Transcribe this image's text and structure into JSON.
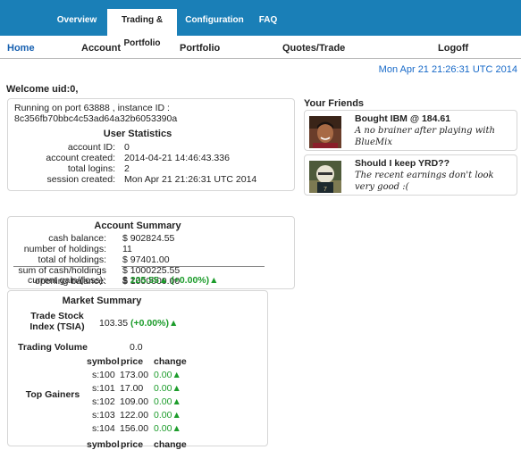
{
  "tabs": [
    {
      "label": "Overview"
    },
    {
      "label": "Trading & Portfolio"
    },
    {
      "label": "Configuration"
    },
    {
      "label": "FAQ"
    }
  ],
  "subnav": {
    "home": "Home",
    "account": "Account",
    "portfolio": "Portfolio",
    "quotes": "Quotes/Trade",
    "logoff": "Logoff"
  },
  "date": "Mon Apr 21 21:26:31 UTC 2014",
  "welcome": "Welcome  uid:0,",
  "server": {
    "line1": "Running on port 63888 , instance ID :",
    "line2": "8c356fb70bbc4c53ad64a32b6053390a"
  },
  "user_stats": {
    "title": "User Statistics",
    "rows": [
      {
        "label": "account ID:",
        "value": "0"
      },
      {
        "label": "account created:",
        "value": "2014-04-21 14:46:43.336"
      },
      {
        "label": "total logins:",
        "value": "2"
      },
      {
        "label": "session created:",
        "value": "Mon Apr 21 21:26:31 UTC 2014"
      }
    ]
  },
  "account_summary": {
    "title": "Account Summary",
    "rows": [
      {
        "label": "cash balance:",
        "value": "$ 902824.55"
      },
      {
        "label": "number of holdings:",
        "value": "11"
      },
      {
        "label": "total of holdings:",
        "value": "$ 97401.00"
      },
      {
        "label": "sum of cash/holdings",
        "value": "$ 1000225.55"
      },
      {
        "label": "opening balance:",
        "value": "$ 1000000.00"
      }
    ],
    "gain_label": "current gain/(loss):",
    "gain_prefix": "$",
    "gain_value": "225.55",
    "gain_pct": "(+0.00%)"
  },
  "market_summary": {
    "title": "Market Summary",
    "tsia_label": "Trade Stock Index (TSIA)",
    "tsia_value": "103.35",
    "tsia_change": "(+0.00%)",
    "volume_label": "Trading Volume",
    "volume_value": "0.0",
    "gainers_label": "Top Gainers",
    "headers": [
      "symbol",
      "price",
      "change"
    ],
    "gainers": [
      {
        "symbol": "s:100",
        "price": "173.00",
        "change": "0.00"
      },
      {
        "symbol": "s:101",
        "price": "17.00",
        "change": "0.00"
      },
      {
        "symbol": "s:102",
        "price": "109.00",
        "change": "0.00"
      },
      {
        "symbol": "s:103",
        "price": "122.00",
        "change": "0.00"
      },
      {
        "symbol": "s:104",
        "price": "156.00",
        "change": "0.00"
      }
    ],
    "partial_headers": [
      "symbol",
      "price",
      "change"
    ]
  },
  "friends": {
    "title": "Your Friends",
    "items": [
      {
        "title": "Bought IBM @ 184.61",
        "body": "A no brainer after playing with BlueMix"
      },
      {
        "title": "Should I keep YRD??",
        "body": "The recent earnings don't look very good :("
      }
    ]
  },
  "colors": {
    "topbar": "#1a7fb7",
    "link": "#1760b0",
    "gain": "#1c9c2b",
    "date": "#1769c8"
  }
}
